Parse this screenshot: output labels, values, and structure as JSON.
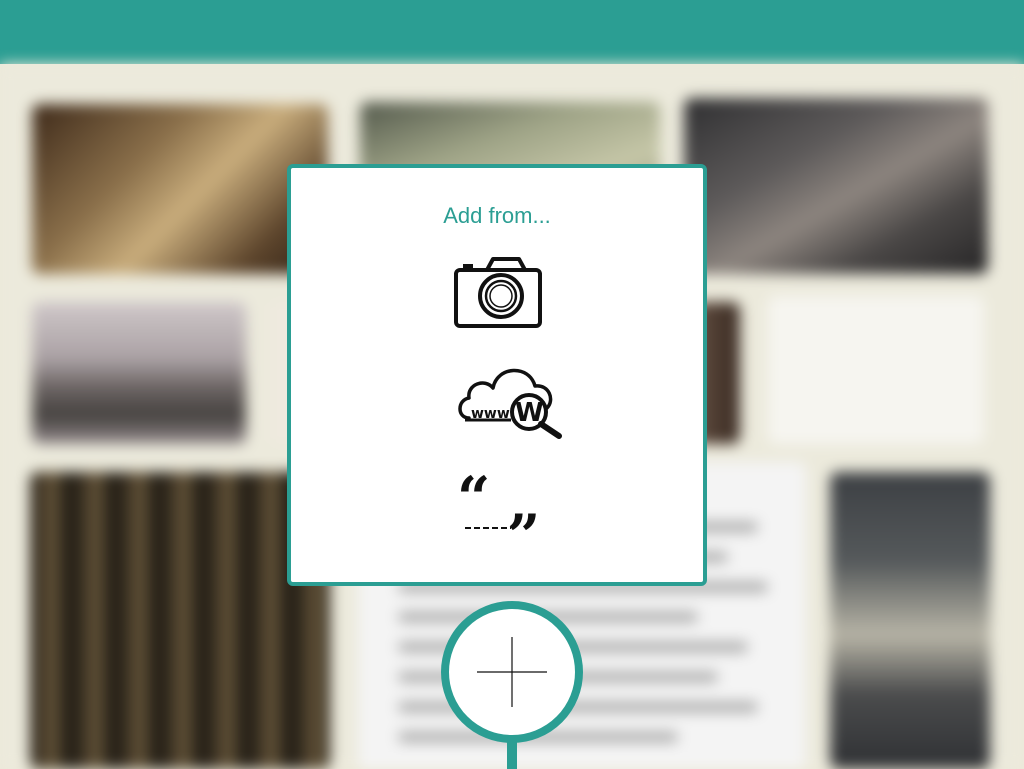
{
  "header": {
    "color": "#2b9e93"
  },
  "background_grid": {
    "tiles": [
      {
        "kind": "photo"
      },
      {
        "kind": "photo"
      },
      {
        "kind": "photo"
      },
      {
        "kind": "photo"
      },
      {
        "kind": "note"
      },
      {
        "kind": "note"
      },
      {
        "kind": "photo"
      },
      {
        "kind": "text-note"
      },
      {
        "kind": "photo"
      }
    ],
    "blurred": true
  },
  "add_from_dialog": {
    "title": "Add from...",
    "accent_color": "#2b9e93",
    "options": [
      {
        "icon": "camera-icon",
        "action": "camera"
      },
      {
        "icon": "web-search-icon",
        "action": "web",
        "icon_text": "www W"
      },
      {
        "icon": "quote-icon",
        "action": "quote"
      }
    ]
  },
  "add_button": {
    "icon": "plus-icon"
  }
}
